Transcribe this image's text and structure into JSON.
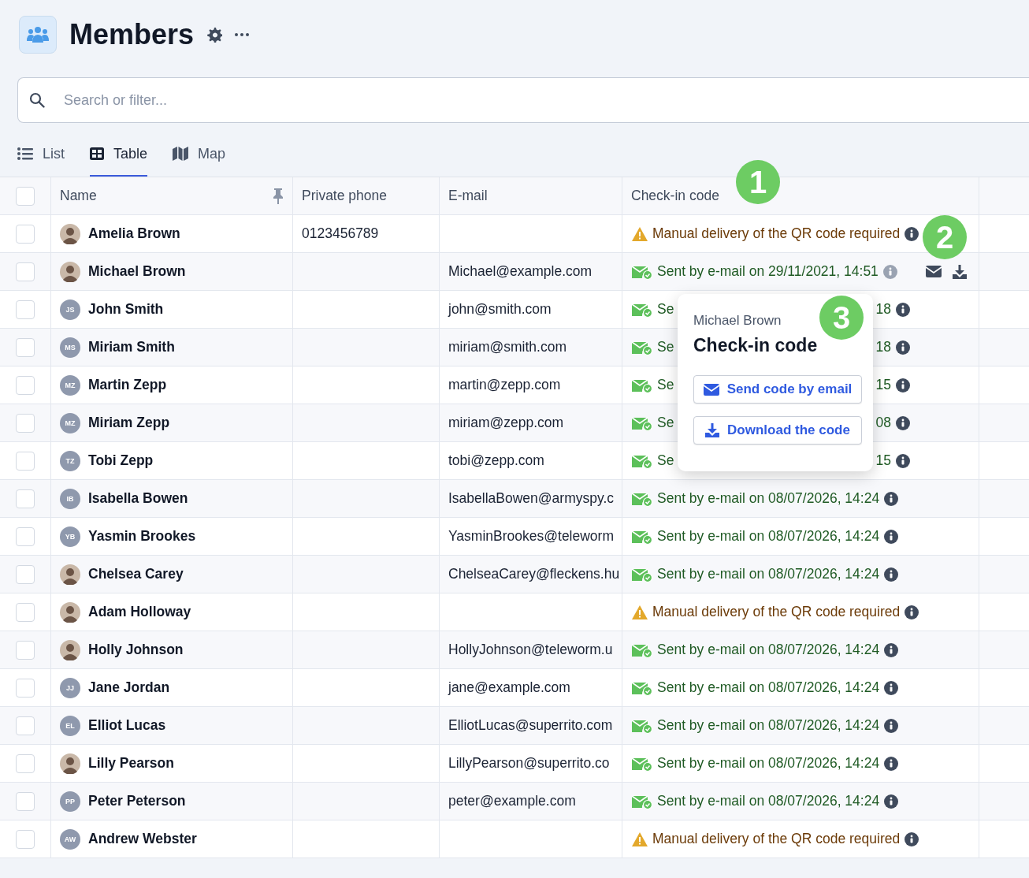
{
  "page": {
    "title": "Members"
  },
  "search": {
    "placeholder": "Search or filter..."
  },
  "tabs": [
    {
      "label": "List",
      "selected": false
    },
    {
      "label": "Table",
      "selected": true
    },
    {
      "label": "Map",
      "selected": false
    }
  ],
  "table": {
    "select_all_checked": false,
    "columns": [
      "Name",
      "Private phone",
      "E-mail",
      "Check-in code"
    ],
    "rows": [
      {
        "checked": false,
        "name": "Amelia Brown",
        "avatar": {
          "kind": "photo"
        },
        "phone": "0123456789",
        "status": {
          "kind": "manual",
          "text": "Manual delivery of the QR code required"
        }
      },
      {
        "checked": false,
        "name": "Michael Brown",
        "avatar": {
          "kind": "photo"
        },
        "email": "Michael@example.com",
        "status": {
          "kind": "sent",
          "text": "Sent by e-mail on 29/11/2021, 14:51"
        },
        "hovered": true
      },
      {
        "checked": false,
        "name": "John Smith",
        "avatar": {
          "kind": "initials",
          "initials": "JS"
        },
        "email": "john@smith.com",
        "status": {
          "kind": "sent",
          "text_start": "Se",
          "text_end": "18"
        }
      },
      {
        "checked": false,
        "name": "Miriam Smith",
        "avatar": {
          "kind": "initials",
          "initials": "MS"
        },
        "email": "miriam@smith.com",
        "status": {
          "kind": "sent",
          "text_start": "Se",
          "text_end": "18"
        }
      },
      {
        "checked": false,
        "name": "Martin Zepp",
        "avatar": {
          "kind": "initials",
          "initials": "MZ"
        },
        "email": "martin@zepp.com",
        "status": {
          "kind": "sent",
          "text_start": "Se",
          "text_end": "15"
        }
      },
      {
        "checked": false,
        "name": "Miriam Zepp",
        "avatar": {
          "kind": "initials",
          "initials": "MZ"
        },
        "email": "miriam@zepp.com",
        "status": {
          "kind": "sent",
          "text_start": "Se",
          "text_end": "08"
        }
      },
      {
        "checked": false,
        "name": "Tobi Zepp",
        "avatar": {
          "kind": "initials",
          "initials": "TZ"
        },
        "email": "tobi@zepp.com",
        "status": {
          "kind": "sent",
          "text_start": "Se",
          "text_end": "15"
        }
      },
      {
        "checked": false,
        "name": "Isabella Bowen",
        "avatar": {
          "kind": "initials",
          "initials": "IB"
        },
        "email": "IsabellaBowen@armyspy.c",
        "status": {
          "kind": "sent",
          "text": "Sent by e-mail on 08/07/2026, 14:24"
        }
      },
      {
        "checked": false,
        "name": "Yasmin Brookes",
        "avatar": {
          "kind": "initials",
          "initials": "YB"
        },
        "email": "YasminBrookes@teleworm",
        "status": {
          "kind": "sent",
          "text": "Sent by e-mail on 08/07/2026, 14:24"
        }
      },
      {
        "checked": false,
        "name": "Chelsea Carey",
        "avatar": {
          "kind": "photo"
        },
        "email": "ChelseaCarey@fleckens.hu",
        "status": {
          "kind": "sent",
          "text": "Sent by e-mail on 08/07/2026, 14:24"
        }
      },
      {
        "checked": false,
        "name": "Adam Holloway",
        "avatar": {
          "kind": "photo"
        },
        "status": {
          "kind": "manual",
          "text": "Manual delivery of the QR code required"
        }
      },
      {
        "checked": false,
        "name": "Holly Johnson",
        "avatar": {
          "kind": "photo"
        },
        "email": "HollyJohnson@teleworm.u",
        "status": {
          "kind": "sent",
          "text": "Sent by e-mail on 08/07/2026, 14:24"
        }
      },
      {
        "checked": false,
        "name": "Jane Jordan",
        "avatar": {
          "kind": "initials",
          "initials": "JJ"
        },
        "email": "jane@example.com",
        "status": {
          "kind": "sent",
          "text": "Sent by e-mail on 08/07/2026, 14:24"
        }
      },
      {
        "checked": false,
        "name": "Elliot Lucas",
        "avatar": {
          "kind": "initials",
          "initials": "EL"
        },
        "email": "ElliotLucas@superrito.com",
        "status": {
          "kind": "sent",
          "text": "Sent by e-mail on 08/07/2026, 14:24"
        }
      },
      {
        "checked": false,
        "name": "Lilly Pearson",
        "avatar": {
          "kind": "photo"
        },
        "email": "LillyPearson@superrito.co",
        "status": {
          "kind": "sent",
          "text": "Sent by e-mail on 08/07/2026, 14:24"
        }
      },
      {
        "checked": false,
        "name": "Peter Peterson",
        "avatar": {
          "kind": "initials",
          "initials": "PP"
        },
        "email": "peter@example.com",
        "status": {
          "kind": "sent",
          "text": "Sent by e-mail on 08/07/2026, 14:24"
        }
      },
      {
        "checked": false,
        "name": "Andrew Webster",
        "avatar": {
          "kind": "initials",
          "initials": "AW"
        },
        "status": {
          "kind": "manual",
          "text": "Manual delivery of the QR code required"
        }
      }
    ]
  },
  "popover": {
    "subtitle": "Michael Brown",
    "title": "Check-in code",
    "buttons": [
      "Send code by email",
      "Download the code"
    ]
  },
  "callouts": [
    "1",
    "2",
    "3"
  ]
}
